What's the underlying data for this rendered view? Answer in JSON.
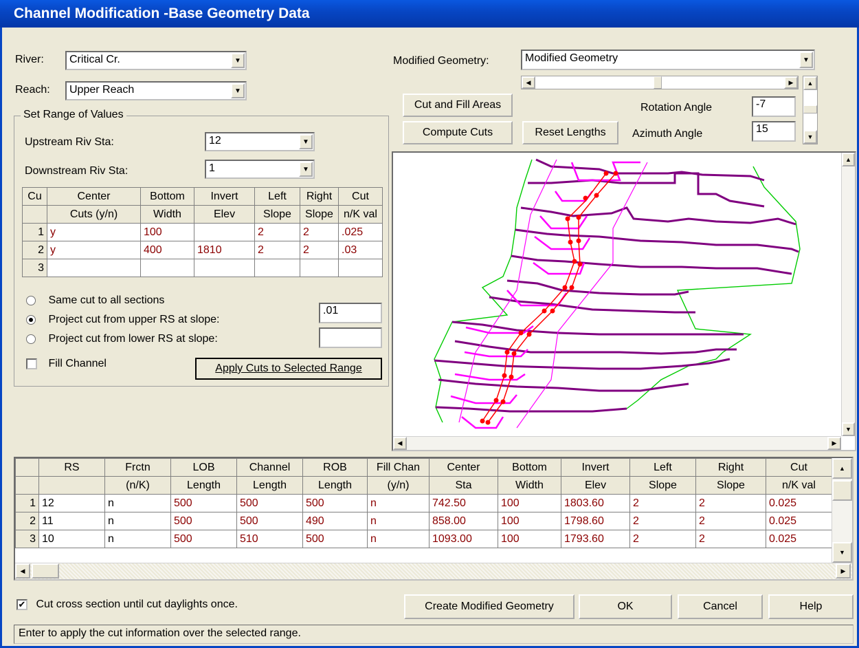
{
  "window": {
    "title": "Channel Modification -Base Geometry Data"
  },
  "river": {
    "label": "River:",
    "value": "Critical Cr."
  },
  "reach": {
    "label": "Reach:",
    "value": "Upper Reach"
  },
  "range": {
    "group_label": "Set Range of Values",
    "upstream_label": "Upstream Riv Sta:",
    "upstream_value": "12",
    "downstream_label": "Downstream Riv Sta:",
    "downstream_value": "1"
  },
  "cut_table": {
    "headers_top": [
      "Cu",
      "Center",
      "Bottom",
      "Invert",
      "Left",
      "Right",
      "Cut"
    ],
    "headers_bottom": [
      "",
      "Cuts (y/n)",
      "Width",
      "Elev",
      "Slope",
      "Slope",
      "n/K val"
    ],
    "rows": [
      [
        "1",
        "y",
        "100",
        "",
        "2",
        "2",
        ".025"
      ],
      [
        "2",
        "y",
        "400",
        "1810",
        "2",
        "2",
        ".03"
      ],
      [
        "3",
        "",
        "",
        "",
        "",
        "",
        ""
      ]
    ]
  },
  "options": {
    "same_cut": "Same cut to all sections",
    "project_upper": "Project cut from upper RS at slope:",
    "project_lower": "Project cut from lower RS at slope:",
    "upper_slope_value": ".01",
    "lower_slope_value": "",
    "fill_channel": "Fill Channel",
    "apply_button": "Apply Cuts to Selected Range"
  },
  "modified": {
    "label": "Modified Geometry:",
    "value": "Modified Geometry"
  },
  "buttons": {
    "cut_fill": "Cut and Fill Areas",
    "compute_cuts": "Compute Cuts",
    "reset_lengths": "Reset Lengths",
    "create_modified": "Create Modified Geometry",
    "ok": "OK",
    "cancel": "Cancel",
    "help": "Help"
  },
  "angles": {
    "rotation_label": "Rotation Angle",
    "rotation_value": "-7",
    "azimuth_label": "Azimuth Angle",
    "azimuth_value": "15"
  },
  "main_table": {
    "headers_top": [
      "",
      "RS",
      "Frctn",
      "LOB",
      "Channel",
      "ROB",
      "Fill Chan",
      "Center",
      "Bottom",
      "Invert",
      "Left",
      "Right",
      "Cut"
    ],
    "headers_bottom": [
      "",
      "",
      "(n/K)",
      "Length",
      "Length",
      "Length",
      "(y/n)",
      "Sta",
      "Width",
      "Elev",
      "Slope",
      "Slope",
      "n/K val"
    ],
    "rows": [
      [
        "1",
        "12",
        "n",
        "500",
        "500",
        "500",
        "n",
        "742.50",
        "100",
        "1803.60",
        "2",
        "2",
        "0.025"
      ],
      [
        "2",
        "11",
        "n",
        "500",
        "500",
        "490",
        "n",
        "858.00",
        "100",
        "1798.60",
        "2",
        "2",
        "0.025"
      ],
      [
        "3",
        "10",
        "n",
        "500",
        "510",
        "500",
        "n",
        "1093.00",
        "100",
        "1793.60",
        "2",
        "2",
        "0.025"
      ]
    ]
  },
  "daylight": {
    "label": "Cut cross section until cut daylights once."
  },
  "status": {
    "text": "Enter to apply the cut information over the selected range."
  },
  "colors": {
    "title_bar": "#0746c4",
    "cut_outline": "#ff00ff",
    "section_line": "#800080",
    "bank_line": "#00cc00",
    "cut_line": "#ff0000"
  }
}
